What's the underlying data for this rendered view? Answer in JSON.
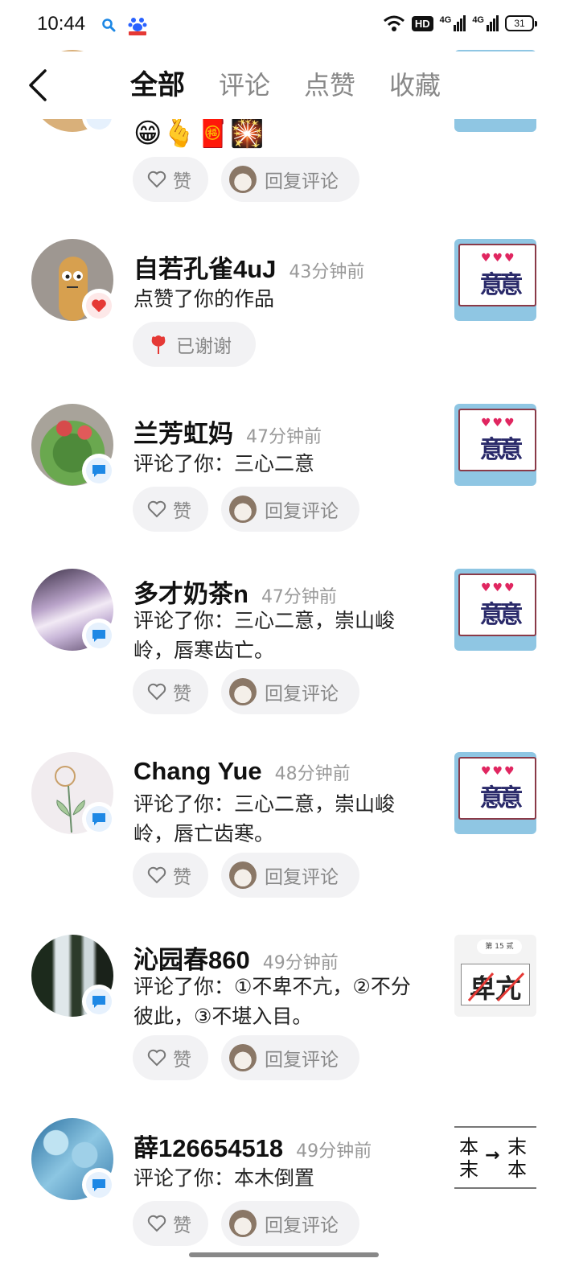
{
  "status_bar": {
    "time": "10:44",
    "icons": [
      "search-icon",
      "app-icon",
      "wifi-icon",
      "hd-icon",
      "signal-icon",
      "signal-icon",
      "battery-icon"
    ],
    "hd": "HD",
    "signal_label": "4G",
    "battery": "31"
  },
  "header": {
    "back_icon": "chevron-left-icon",
    "tabs": [
      {
        "label": "全部",
        "active": true
      },
      {
        "label": "评论",
        "active": false
      },
      {
        "label": "点赞",
        "active": false
      },
      {
        "label": "收藏",
        "active": false
      }
    ]
  },
  "partial_item": {
    "emojis": "😁🫰🧧🎇",
    "like_label": "赞",
    "reply_label": "回复评论"
  },
  "notifications": [
    {
      "name": "自若孔雀4uJ",
      "time": "43分钟前",
      "text": "点赞了你的作品",
      "type": "like",
      "action_label": "已谢谢"
    },
    {
      "name": "兰芳虹妈",
      "time": "47分钟前",
      "text": "评论了你：三心二意",
      "type": "comment",
      "like_label": "赞",
      "reply_label": "回复评论"
    },
    {
      "name": "多才奶茶n",
      "time": "47分钟前",
      "text": "评论了你：三心二意，崇山峻岭，唇寒齿亡。",
      "type": "comment",
      "like_label": "赞",
      "reply_label": "回复评论"
    },
    {
      "name": "Chang Yue",
      "time": "48分钟前",
      "text": "评论了你：三心二意，崇山峻岭，唇亡齿寒。",
      "type": "comment",
      "like_label": "赞",
      "reply_label": "回复评论"
    },
    {
      "name": "沁园春860",
      "time": "49分钟前",
      "text": "评论了你：①不卑不亢，②不分彼此，③不堪入目。",
      "type": "comment",
      "like_label": "赞",
      "reply_label": "回复评论"
    },
    {
      "name": "薛126654518",
      "time": "49分钟前",
      "text": "评论了你：本木倒置",
      "type": "comment",
      "like_label": "赞",
      "reply_label": "回复评论"
    }
  ],
  "thumbs": {
    "puzzle_word": "意意",
    "page_label": "第 15 贰",
    "cross_word": "卑亢",
    "swap_left": "本末",
    "swap_right": "末本",
    "swap_arrow": "→"
  },
  "colors": {
    "accent_blue": "#1e88e5",
    "like_red": "#e53935",
    "muted_text": "#999999",
    "button_bg": "#f2f2f4"
  }
}
